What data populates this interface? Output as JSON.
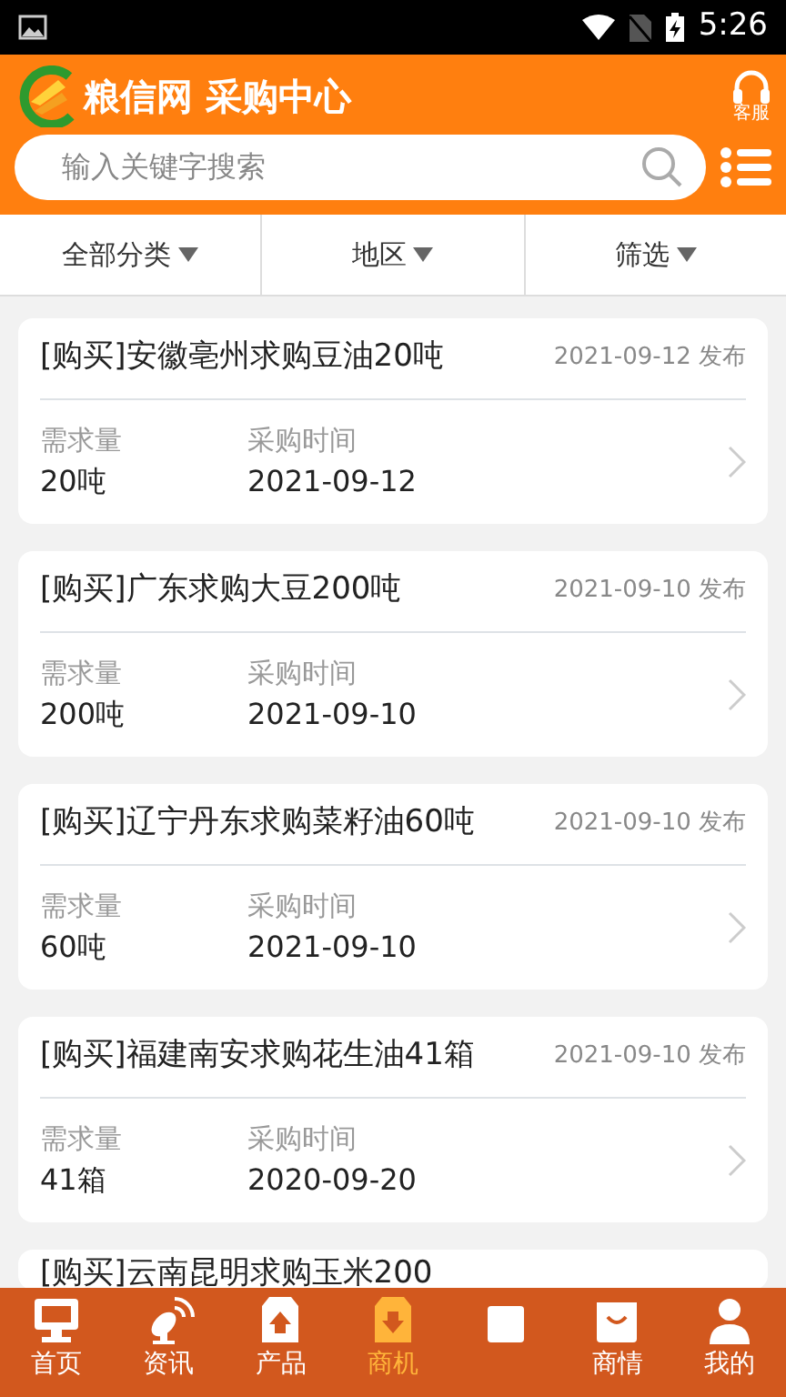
{
  "status_bar": {
    "time": "5:26"
  },
  "header": {
    "title": "粮信网 采购中心",
    "service_label": "客服"
  },
  "search": {
    "placeholder": "输入关键字搜索"
  },
  "filters": [
    {
      "label": "全部分类"
    },
    {
      "label": "地区"
    },
    {
      "label": "筛选"
    }
  ],
  "listings": [
    {
      "title": "[购买]安徽亳州求购豆油20吨",
      "posted": "2021-09-12 发布",
      "quantity_label": "需求量",
      "quantity": "20吨",
      "time_label": "采购时间",
      "time": "2021-09-12"
    },
    {
      "title": "[购买]广东求购大豆200吨",
      "posted": "2021-09-10 发布",
      "quantity_label": "需求量",
      "quantity": "200吨",
      "time_label": "采购时间",
      "time": "2021-09-10"
    },
    {
      "title": "[购买]辽宁丹东求购菜籽油60吨",
      "posted": "2021-09-10 发布",
      "quantity_label": "需求量",
      "quantity": "60吨",
      "time_label": "采购时间",
      "time": "2021-09-10"
    },
    {
      "title": "[购买]福建南安求购花生油41箱",
      "posted": "2021-09-10 发布",
      "quantity_label": "需求量",
      "quantity": "41箱",
      "time_label": "采购时间",
      "time": "2020-09-20"
    },
    {
      "title": "[购买]云南昆明求购玉米200"
    }
  ],
  "tabs": [
    {
      "kind": "home",
      "label": "首页",
      "selected": false
    },
    {
      "kind": "news",
      "label": "资讯",
      "selected": false
    },
    {
      "kind": "product",
      "label": "产品",
      "selected": false
    },
    {
      "kind": "business",
      "label": "商机",
      "selected": true
    },
    {
      "kind": "other",
      "selected": false
    },
    {
      "kind": "market",
      "label": "商情",
      "selected": false
    },
    {
      "kind": "me",
      "label": "我的",
      "selected": false
    }
  ]
}
